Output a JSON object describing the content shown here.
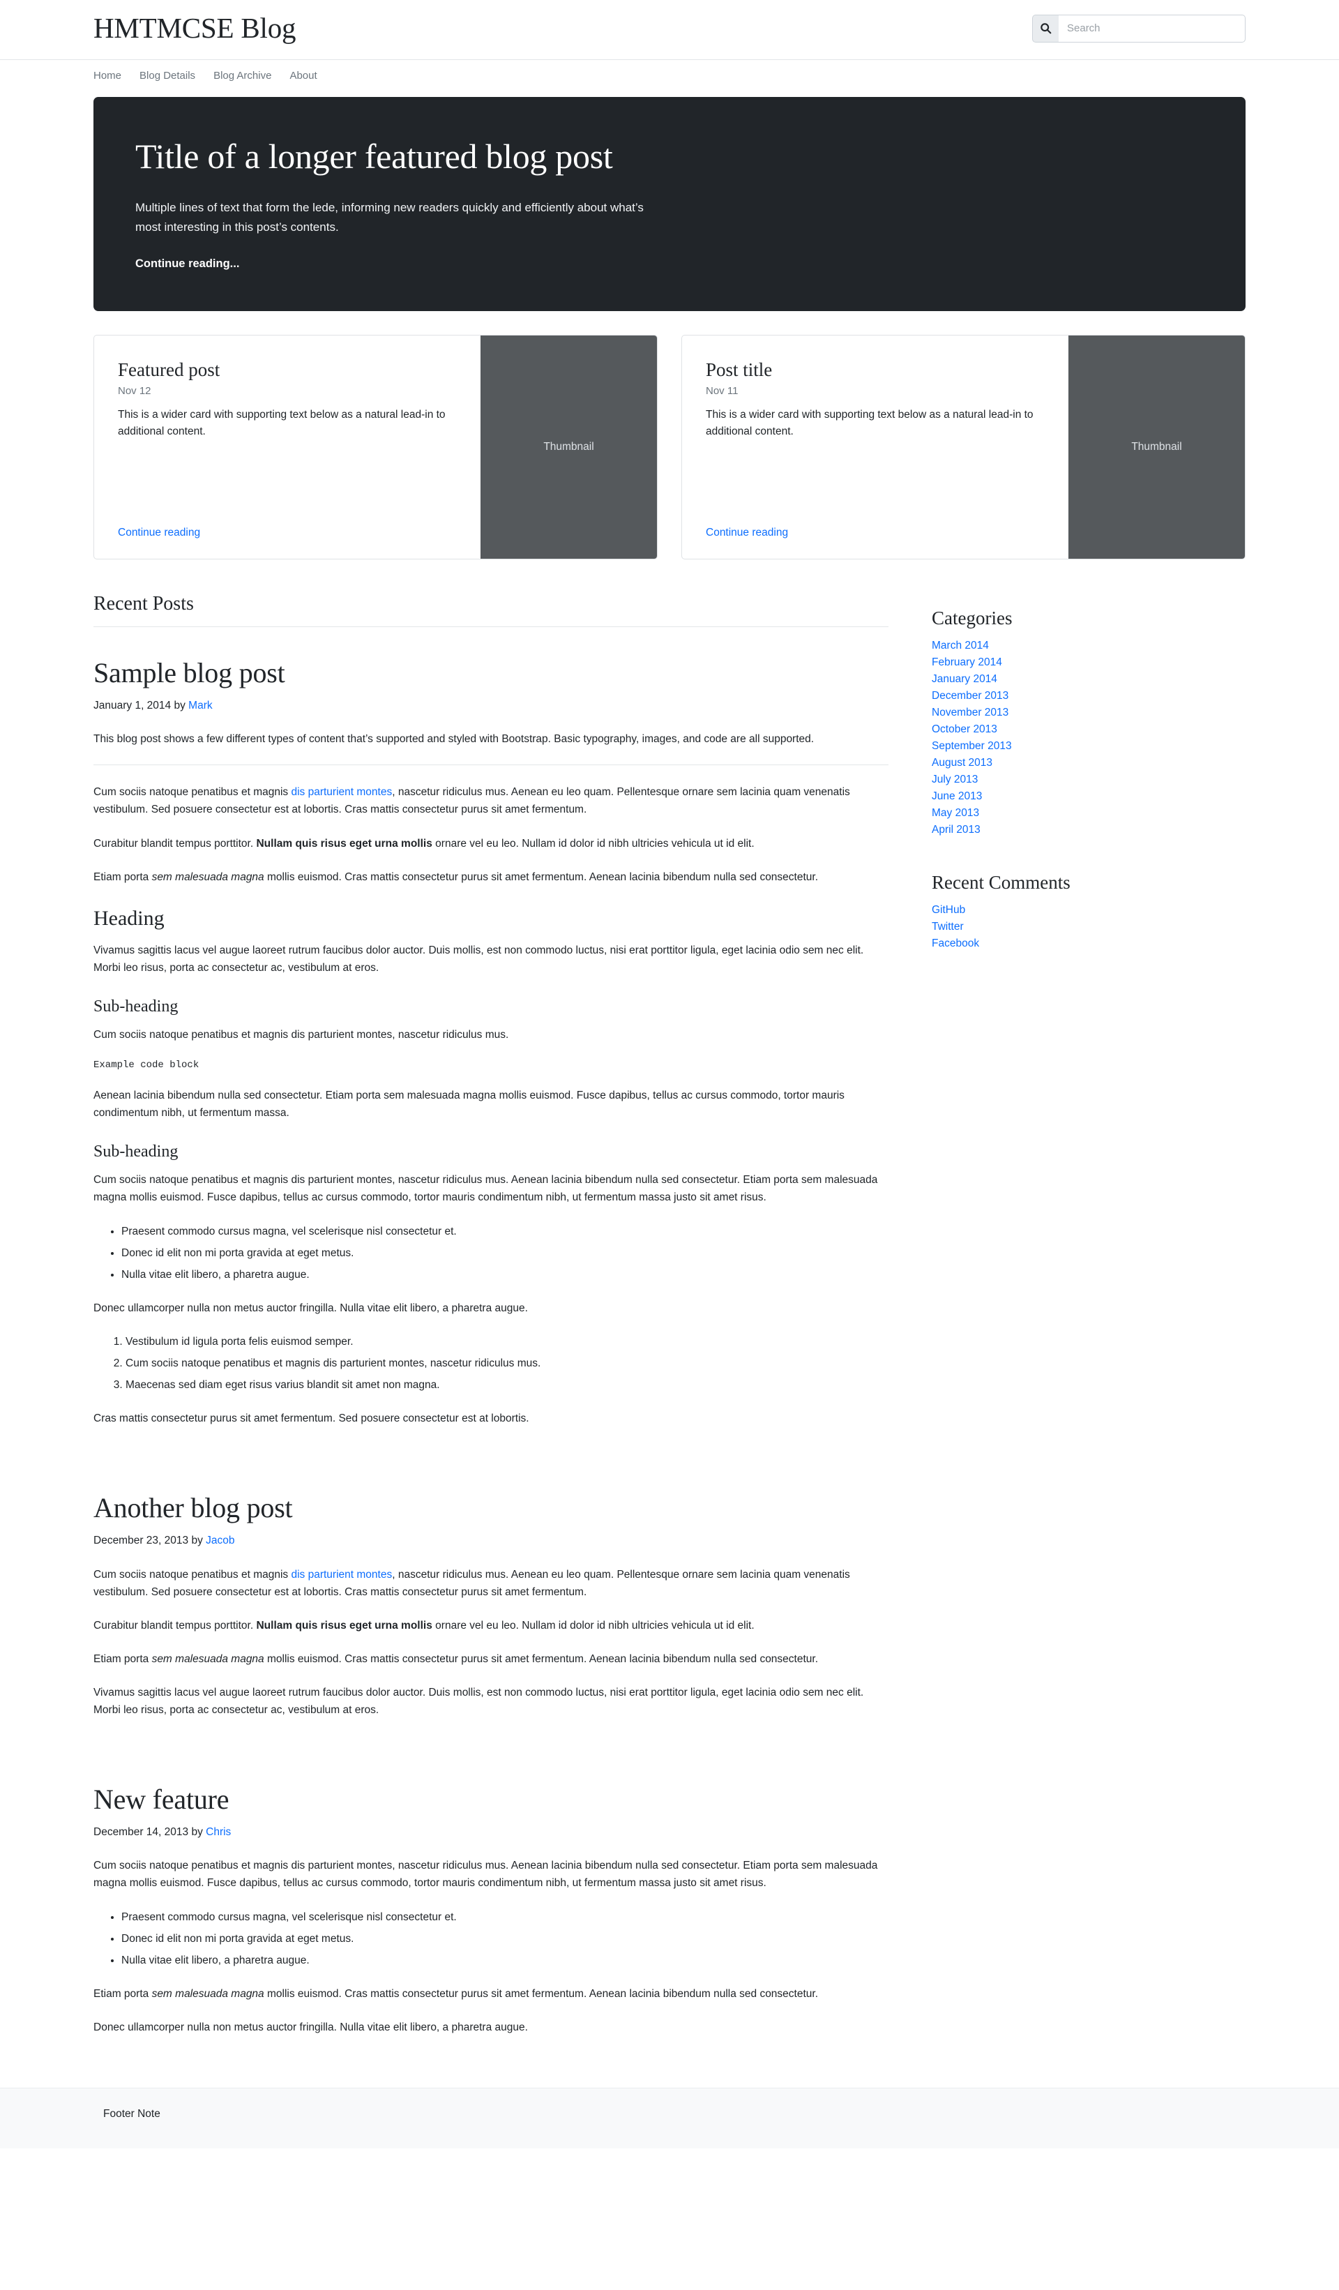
{
  "site": {
    "title": "HMTMCSE Blog",
    "search_placeholder": "Search",
    "search_value": "",
    "search_icon": "search-icon"
  },
  "nav": {
    "items": [
      {
        "label": "Home"
      },
      {
        "label": "Blog Details"
      },
      {
        "label": "Blog Archive"
      },
      {
        "label": "About"
      }
    ]
  },
  "hero": {
    "title": "Title of a longer featured blog post",
    "lede": "Multiple lines of text that form the lede, informing new readers quickly and efficiently about what’s most interesting in this post’s contents.",
    "cta": "Continue reading...",
    "bg_color": "#212529"
  },
  "cards": [
    {
      "title": "Featured post",
      "date": "Nov 12",
      "text": "This is a wider card with supporting text below as a natural lead-in to additional content.",
      "link": "Continue reading",
      "thumb_label": "Thumbnail",
      "thumb_color": "#55595c"
    },
    {
      "title": "Post title",
      "date": "Nov 11",
      "text": "This is a wider card with supporting text below as a natural lead-in to additional content.",
      "link": "Continue reading",
      "thumb_label": "Thumbnail",
      "thumb_color": "#55595c"
    }
  ],
  "main": {
    "section_heading": "Recent Posts",
    "posts": [
      {
        "title": "Sample blog post",
        "meta_date": "January 1, 2014 by",
        "meta_author": "Mark",
        "intro": "This blog post shows a few different types of content that’s supported and styled with Bootstrap. Basic typography, images, and code are all supported.",
        "p1_a": "Cum sociis natoque penatibus et magnis ",
        "p1_link": "dis parturient montes",
        "p1_b": ", nascetur ridiculus mus. Aenean eu leo quam. Pellentesque ornare sem lacinia quam venenatis vestibulum. Sed posuere consectetur est at lobortis. Cras mattis consectetur purus sit amet fermentum.",
        "p2_a": "Curabitur blandit tempus porttitor. ",
        "p2_bold": "Nullam quis risus eget urna mollis",
        "p2_b": " ornare vel eu leo. Nullam id dolor id nibh ultricies vehicula ut id elit.",
        "p3_a": "Etiam porta ",
        "p3_em": "sem malesuada magna",
        "p3_b": " mollis euismod. Cras mattis consectetur purus sit amet fermentum. Aenean lacinia bibendum nulla sed consectetur.",
        "h_heading": "Heading",
        "p4": "Vivamus sagittis lacus vel augue laoreet rutrum faucibus dolor auctor. Duis mollis, est non commodo luctus, nisi erat porttitor ligula, eget lacinia odio sem nec elit. Morbi leo risus, porta ac consectetur ac, vestibulum at eros.",
        "h_sub1": "Sub-heading",
        "p5": "Cum sociis natoque penatibus et magnis dis parturient montes, nascetur ridiculus mus.",
        "code": "Example code block",
        "p6": "Aenean lacinia bibendum nulla sed consectetur. Etiam porta sem malesuada magna mollis euismod. Fusce dapibus, tellus ac cursus commodo, tortor mauris condimentum nibh, ut fermentum massa.",
        "h_sub2": "Sub-heading",
        "p7": "Cum sociis natoque penatibus et magnis dis parturient montes, nascetur ridiculus mus. Aenean lacinia bibendum nulla sed consectetur. Etiam porta sem malesuada magna mollis euismod. Fusce dapibus, tellus ac cursus commodo, tortor mauris condimentum nibh, ut fermentum massa justo sit amet risus.",
        "ul": [
          "Praesent commodo cursus magna, vel scelerisque nisl consectetur et.",
          "Donec id elit non mi porta gravida at eget metus.",
          "Nulla vitae elit libero, a pharetra augue."
        ],
        "p8": "Donec ullamcorper nulla non metus auctor fringilla. Nulla vitae elit libero, a pharetra augue.",
        "ol": [
          "Vestibulum id ligula porta felis euismod semper.",
          "Cum sociis natoque penatibus et magnis dis parturient montes, nascetur ridiculus mus.",
          "Maecenas sed diam eget risus varius blandit sit amet non magna."
        ],
        "p9": "Cras mattis consectetur purus sit amet fermentum. Sed posuere consectetur est at lobortis."
      },
      {
        "title": "Another blog post",
        "meta_date": "December 23, 2013 by",
        "meta_author": "Jacob",
        "p1_a": "Cum sociis natoque penatibus et magnis ",
        "p1_link": "dis parturient montes",
        "p1_b": ", nascetur ridiculus mus. Aenean eu leo quam. Pellentesque ornare sem lacinia quam venenatis vestibulum. Sed posuere consectetur est at lobortis. Cras mattis consectetur purus sit amet fermentum.",
        "p2_a": "Curabitur blandit tempus porttitor. ",
        "p2_bold": "Nullam quis risus eget urna mollis",
        "p2_b": " ornare vel eu leo. Nullam id dolor id nibh ultricies vehicula ut id elit.",
        "p3_a": "Etiam porta ",
        "p3_em": "sem malesuada magna",
        "p3_b": " mollis euismod. Cras mattis consectetur purus sit amet fermentum. Aenean lacinia bibendum nulla sed consectetur.",
        "p4": "Vivamus sagittis lacus vel augue laoreet rutrum faucibus dolor auctor. Duis mollis, est non commodo luctus, nisi erat porttitor ligula, eget lacinia odio sem nec elit. Morbi leo risus, porta ac consectetur ac, vestibulum at eros."
      },
      {
        "title": "New feature",
        "meta_date": "December 14, 2013 by",
        "meta_author": "Chris",
        "p1": "Cum sociis natoque penatibus et magnis dis parturient montes, nascetur ridiculus mus. Aenean lacinia bibendum nulla sed consectetur. Etiam porta sem malesuada magna mollis euismod. Fusce dapibus, tellus ac cursus commodo, tortor mauris condimentum nibh, ut fermentum massa justo sit amet risus.",
        "ul": [
          "Praesent commodo cursus magna, vel scelerisque nisl consectetur et.",
          "Donec id elit non mi porta gravida at eget metus.",
          "Nulla vitae elit libero, a pharetra augue."
        ],
        "p2_a": "Etiam porta ",
        "p2_em": "sem malesuada magna",
        "p2_b": " mollis euismod. Cras mattis consectetur purus sit amet fermentum. Aenean lacinia bibendum nulla sed consectetur.",
        "p3": "Donec ullamcorper nulla non metus auctor fringilla. Nulla vitae elit libero, a pharetra augue."
      }
    ]
  },
  "sidebar": {
    "categories_heading": "Categories",
    "categories": [
      {
        "label": "March 2014"
      },
      {
        "label": "February 2014"
      },
      {
        "label": "January 2014"
      },
      {
        "label": "December 2013"
      },
      {
        "label": "November 2013"
      },
      {
        "label": "October 2013"
      },
      {
        "label": "September 2013"
      },
      {
        "label": "August 2013"
      },
      {
        "label": "July 2013"
      },
      {
        "label": "June 2013"
      },
      {
        "label": "May 2013"
      },
      {
        "label": "April 2013"
      }
    ],
    "comments_heading": "Recent Comments",
    "comments": [
      {
        "label": "GitHub"
      },
      {
        "label": "Twitter"
      },
      {
        "label": "Facebook"
      }
    ]
  },
  "footer": {
    "note": "Footer Note"
  },
  "colors": {
    "link": "#0d6efd",
    "muted": "#6c757d",
    "dark": "#212529",
    "footer_bg": "#f8f9fa"
  }
}
